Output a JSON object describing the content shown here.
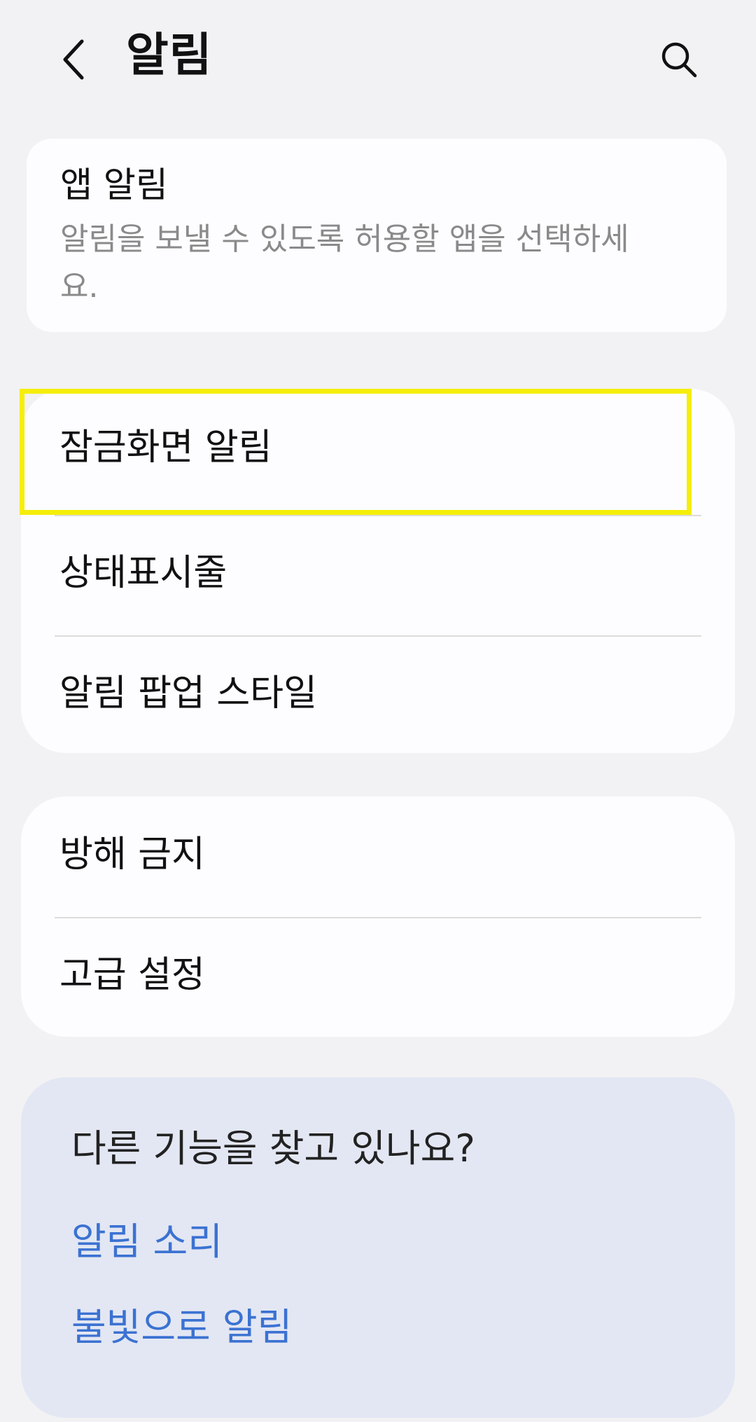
{
  "header": {
    "title": "알림",
    "back_icon": "back-arrow-icon",
    "search_icon": "search-icon"
  },
  "app_notifications": {
    "title": "앱 알림",
    "description": "알림을 보낼 수 있도록 허용할 앱을 선택하세요."
  },
  "group1": {
    "items": [
      {
        "label": "잠금화면 알림"
      },
      {
        "label": "상태표시줄"
      },
      {
        "label": "알림 팝업 스타일"
      }
    ]
  },
  "group2": {
    "items": [
      {
        "label": "방해 금지"
      },
      {
        "label": "고급 설정"
      }
    ]
  },
  "suggestions": {
    "title": "다른 기능을 찾고 있나요?",
    "links": [
      {
        "label": "알림 소리"
      },
      {
        "label": "불빛으로 알림"
      }
    ]
  },
  "colors": {
    "background": "#f2f2f4",
    "card": "#fdfdff",
    "suggestion_card": "#e3e7f3",
    "link": "#3b72d2",
    "highlight": "#f5ee0a"
  }
}
